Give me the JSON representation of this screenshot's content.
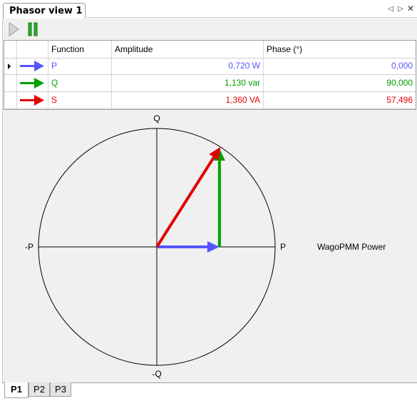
{
  "window": {
    "tab_title": "Phasor view 1"
  },
  "toolbar": {
    "play_icon": "play-icon",
    "pause_icon": "pause-icon"
  },
  "grid": {
    "columns": [
      "",
      "",
      "Function",
      "Amplitude",
      "Phase (°)"
    ],
    "rows": [
      {
        "function": "P",
        "amplitude": "0,720 W",
        "phase": "0,000",
        "color": "#5555ff"
      },
      {
        "function": "Q",
        "amplitude": "1,130 var",
        "phase": "90,000",
        "color": "#00a000"
      },
      {
        "function": "S",
        "amplitude": "1,360 VA",
        "phase": "57,496",
        "color": "#e00000"
      }
    ]
  },
  "diagram": {
    "axis_top": "Q",
    "axis_bottom": "-Q",
    "axis_left": "-P",
    "axis_right": "P",
    "source_label": "WagoPMM Power",
    "circle_max": 1.36,
    "vectors": [
      {
        "name": "P",
        "magnitude": 0.72,
        "phase_deg": 0,
        "color": "#5555ff",
        "origin": "center"
      },
      {
        "name": "Q",
        "magnitude": 1.13,
        "phase_deg": 90,
        "color": "#00a000",
        "origin": "tip-P"
      },
      {
        "name": "S",
        "magnitude": 1.36,
        "phase_deg": 57.496,
        "color": "#e00000",
        "origin": "center"
      }
    ]
  },
  "bottom_tabs": [
    {
      "label": "P1",
      "active": true
    },
    {
      "label": "P2",
      "active": false
    },
    {
      "label": "P3",
      "active": false
    }
  ]
}
